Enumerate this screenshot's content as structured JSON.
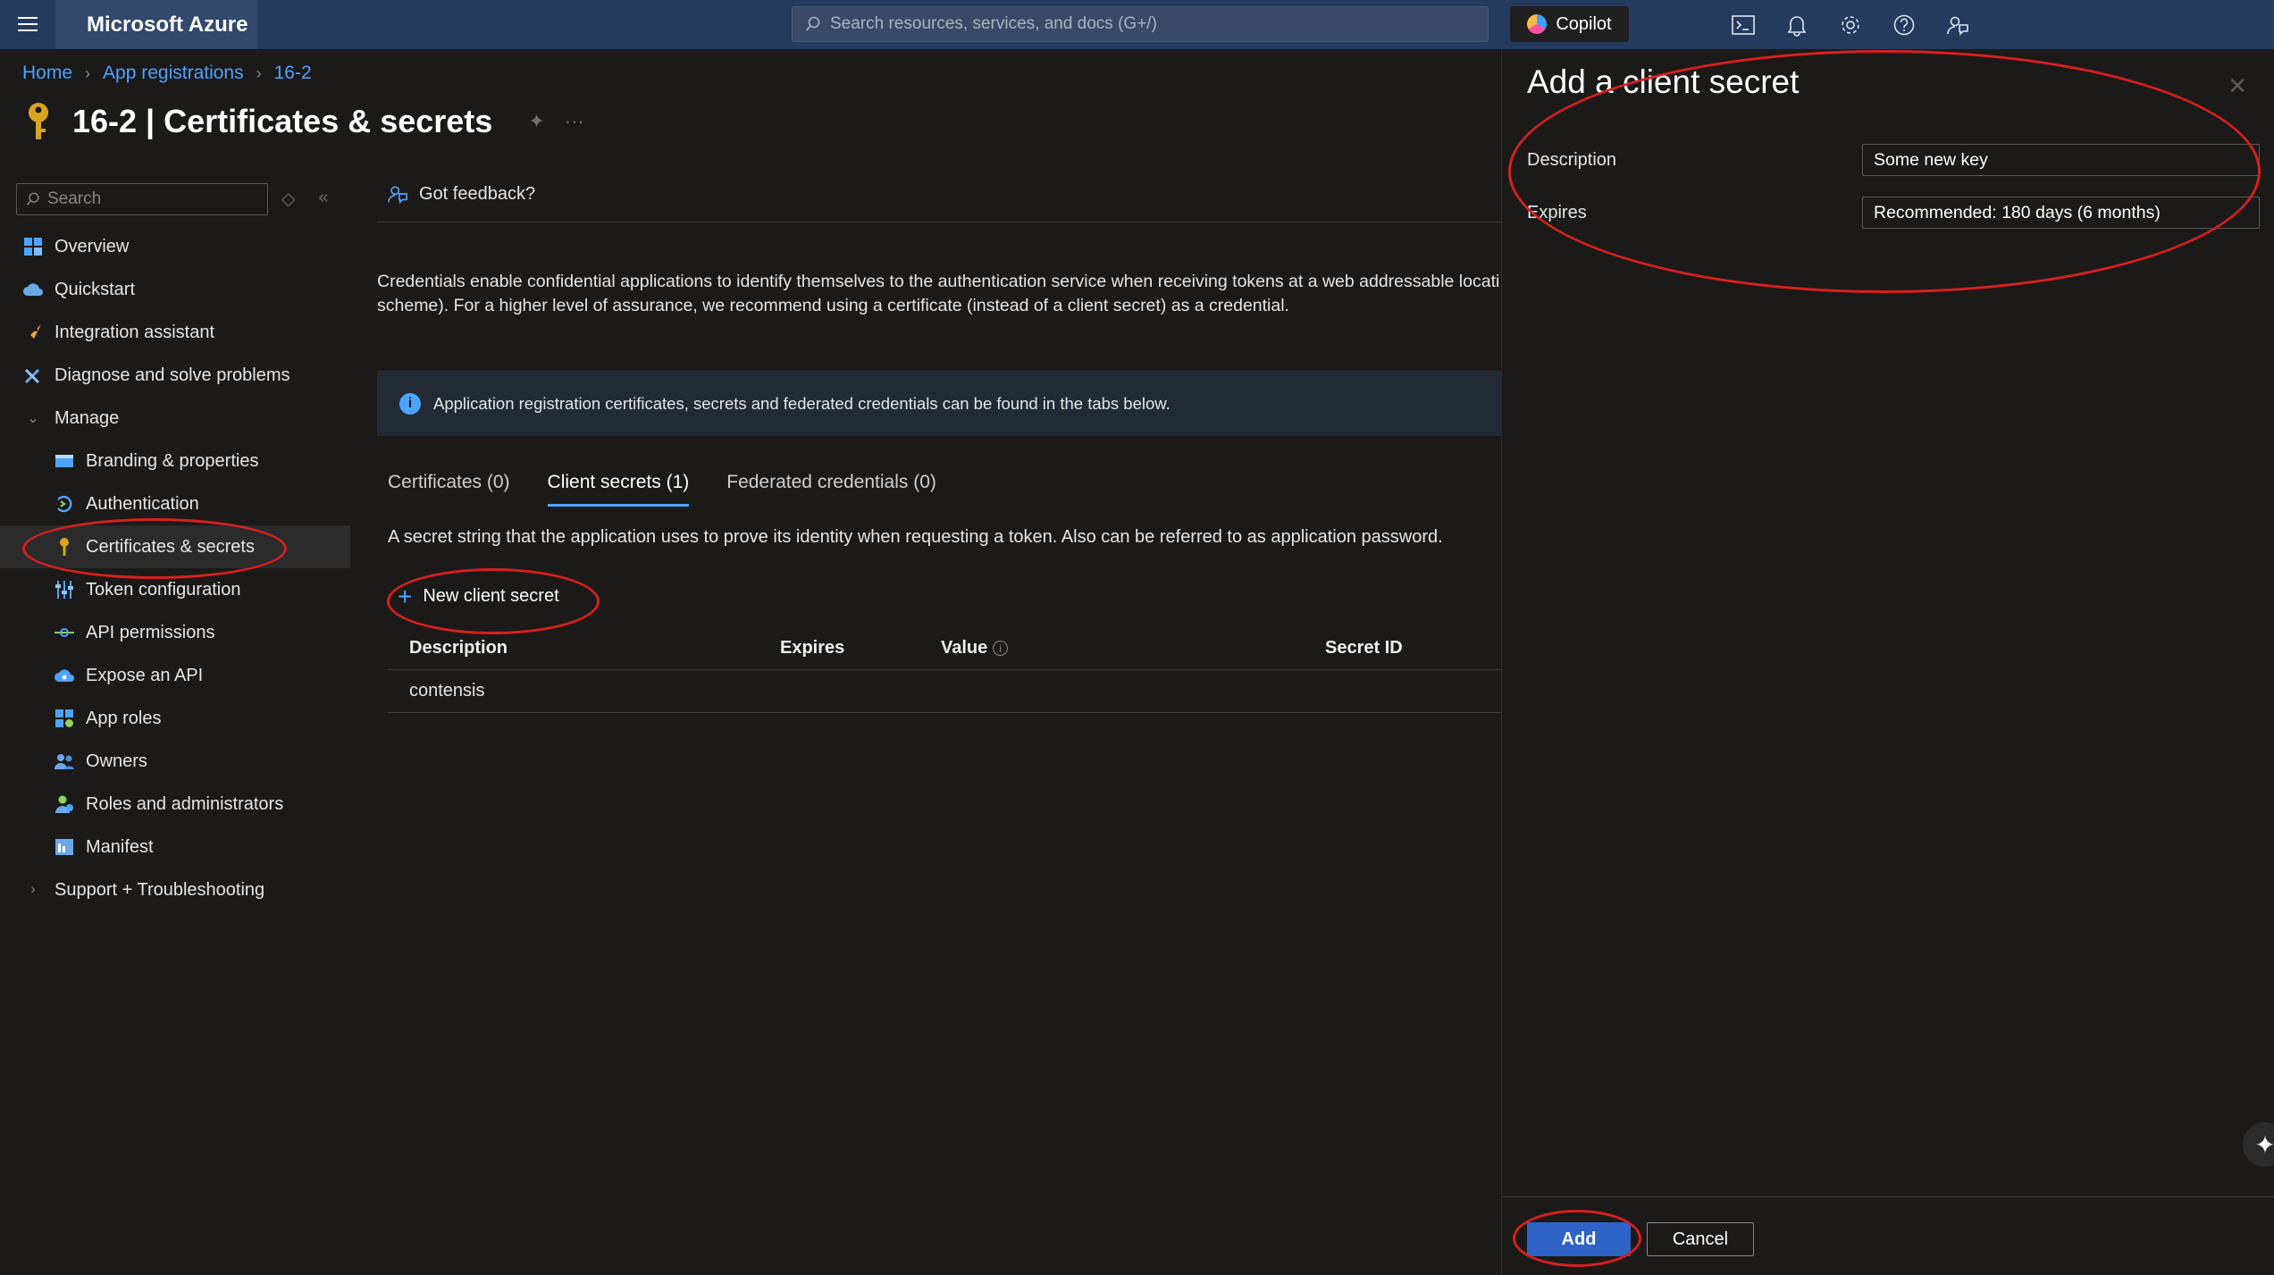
{
  "topbar": {
    "brand": "Microsoft Azure",
    "search_placeholder": "Search resources, services, and docs (G+/)",
    "copilot_label": "Copilot",
    "icons": [
      "cloud-shell-icon",
      "bell-icon",
      "gear-icon",
      "help-icon",
      "feedback-icon"
    ]
  },
  "breadcrumb": {
    "items": [
      "Home",
      "App registrations",
      "16-2"
    ]
  },
  "page": {
    "title": "16-2 | Certificates & secrets"
  },
  "nav": {
    "search_placeholder": "Search",
    "items": [
      {
        "label": "Overview",
        "icon": "grid-icon"
      },
      {
        "label": "Quickstart",
        "icon": "cloud-icon"
      },
      {
        "label": "Integration assistant",
        "icon": "rocket-icon"
      },
      {
        "label": "Diagnose and solve problems",
        "icon": "wrench-icon"
      },
      {
        "label": "Manage",
        "icon": "chevron-down-icon"
      },
      {
        "label": "Branding & properties",
        "icon": "branding-icon"
      },
      {
        "label": "Authentication",
        "icon": "auth-icon"
      },
      {
        "label": "Certificates & secrets",
        "icon": "key-icon"
      },
      {
        "label": "Token configuration",
        "icon": "sliders-icon"
      },
      {
        "label": "API permissions",
        "icon": "api-icon"
      },
      {
        "label": "Expose an API",
        "icon": "cloud-api-icon"
      },
      {
        "label": "App roles",
        "icon": "app-roles-icon"
      },
      {
        "label": "Owners",
        "icon": "owners-icon"
      },
      {
        "label": "Roles and administrators",
        "icon": "roles-icon"
      },
      {
        "label": "Manifest",
        "icon": "manifest-icon"
      },
      {
        "label": "Support + Troubleshooting",
        "icon": "chevron-right-icon"
      }
    ]
  },
  "main": {
    "feedback_label": "Got feedback?",
    "intro_line1": "Credentials enable confidential applications to identify themselves to the authentication service when receiving tokens at a web addressable locati",
    "intro_line2": "scheme). For a higher level of assurance, we recommend using a certificate (instead of a client secret) as a credential.",
    "info_text": "Application registration certificates, secrets and federated credentials can be found in the tabs below.",
    "tabs": [
      {
        "label": "Certificates (0)"
      },
      {
        "label": "Client secrets (1)"
      },
      {
        "label": "Federated credentials (0)"
      }
    ],
    "tab_description": "A secret string that the application uses to prove its identity when requesting a token. Also can be referred to as application password.",
    "new_secret_label": "New client secret",
    "table": {
      "headers": [
        "Description",
        "Expires",
        "Value",
        "Secret ID"
      ],
      "rows": [
        [
          "contensis",
          "",
          "",
          ""
        ]
      ]
    }
  },
  "panel": {
    "title": "Add a client secret",
    "description_label": "Description",
    "description_value": "Some new key",
    "expires_label": "Expires",
    "expires_value": "Recommended: 180 days (6 months)",
    "add_label": "Add",
    "cancel_label": "Cancel"
  },
  "colors": {
    "topbar_bg": "#243a5e",
    "accent": "#4da3ff",
    "primary_button": "#2e63c7",
    "annotation_red": "#d8201f"
  }
}
